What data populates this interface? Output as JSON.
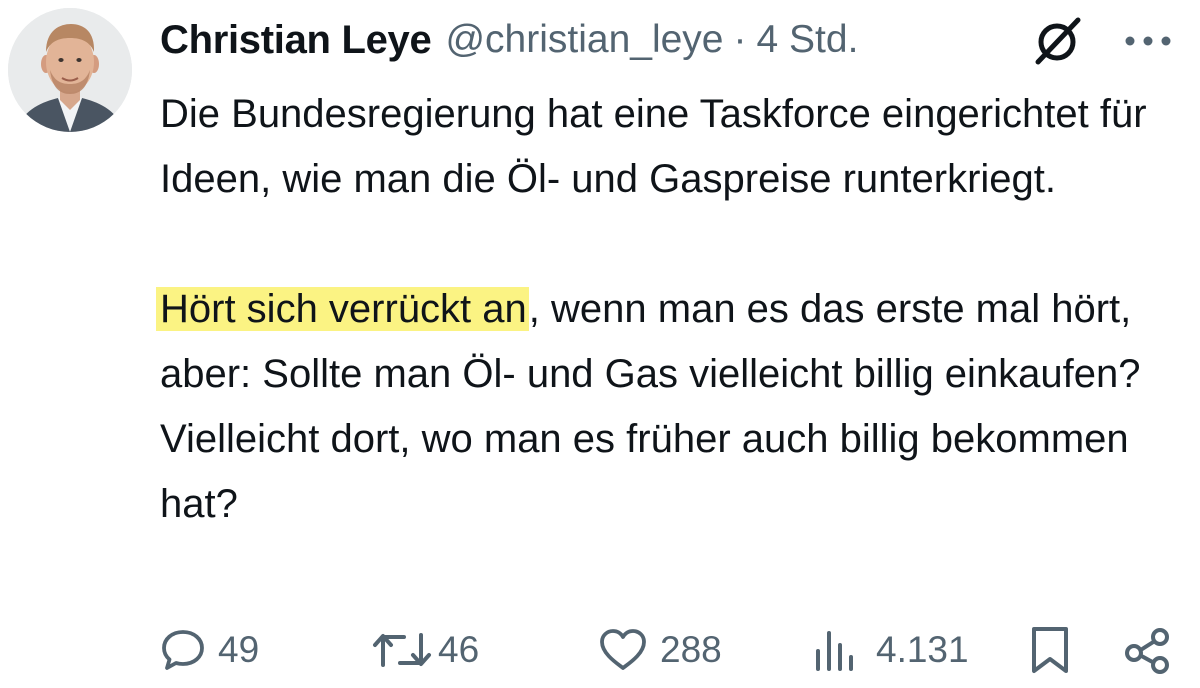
{
  "author": {
    "name": "Christian Leye",
    "handle": "@christian_leye",
    "separator": "·",
    "time": "4 Std."
  },
  "icons": {
    "avatar": "profile-photo",
    "grok": "grok-icon",
    "more": "more-icon",
    "reply": "reply-icon",
    "repost": "repost-icon",
    "like": "like-icon",
    "views": "views-icon",
    "bookmark": "bookmark-icon",
    "share": "share-icon"
  },
  "tweet": {
    "para1": "Die Bundesregierung hat eine Taskforce eingerichtet für Ideen, wie man die Öl- und Gaspreise runterkriegt.",
    "para2_highlight": "Hört sich verrückt an",
    "para2_rest": ", wenn man es das erste mal hört, aber: Sollte man Öl- und Gas vielleicht billig einkaufen? Vielleicht dort, wo man es früher auch billig bekommen hat?",
    "highlight_color": "#fbf383"
  },
  "stats": {
    "replies": "49",
    "reposts": "46",
    "likes": "288",
    "views": "4.131"
  },
  "colors": {
    "text": "#0f1419",
    "secondary": "#536471"
  }
}
